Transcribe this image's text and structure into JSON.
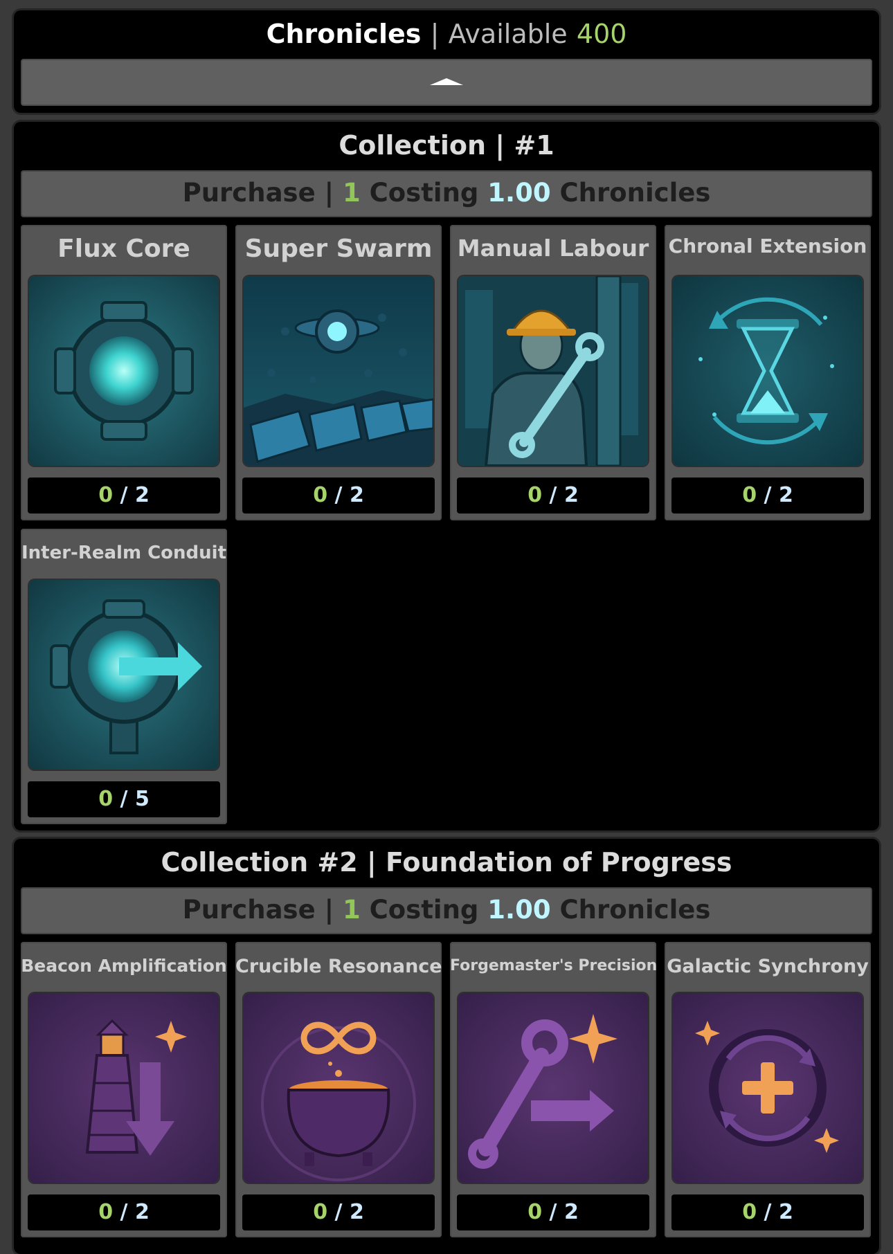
{
  "header": {
    "title": "Chronicles",
    "separator": "|",
    "available_label": "Available",
    "available_value": "400"
  },
  "collections": [
    {
      "title": "Collection | #1",
      "purchase": {
        "label": "Purchase",
        "separator": "|",
        "quantity": "1",
        "costing_label": "Costing",
        "cost": "1.00",
        "currency": "Chronicles"
      },
      "cards": [
        {
          "name": "Flux Core",
          "icon": "flux-core-icon",
          "owned": "0",
          "max": "2"
        },
        {
          "name": "Super Swarm",
          "icon": "drone-swarm-icon",
          "owned": "0",
          "max": "2"
        },
        {
          "name": "Manual Labour",
          "icon": "worker-wrench-icon",
          "owned": "0",
          "max": "2"
        },
        {
          "name": "Chronal Extension",
          "icon": "hourglass-cycle-icon",
          "owned": "0",
          "max": "2"
        },
        {
          "name": "Inter-Realm Conduit",
          "icon": "conduit-arrow-icon",
          "owned": "0",
          "max": "5"
        }
      ]
    },
    {
      "title": "Collection #2 | Foundation of Progress",
      "purchase": {
        "label": "Purchase",
        "separator": "|",
        "quantity": "1",
        "costing_label": "Costing",
        "cost": "1.00",
        "currency": "Chronicles"
      },
      "cards": [
        {
          "name": "Beacon Amplification",
          "icon": "lighthouse-arrow-icon",
          "owned": "0",
          "max": "2"
        },
        {
          "name": "Crucible Resonance",
          "icon": "cauldron-infinity-icon",
          "owned": "0",
          "max": "2"
        },
        {
          "name": "Forgemaster's Precision",
          "icon": "wrench-sparkle-icon",
          "owned": "0",
          "max": "2"
        },
        {
          "name": "Galactic Synchrony",
          "icon": "cycle-plus-icon",
          "owned": "0",
          "max": "2"
        }
      ]
    }
  ],
  "colors": {
    "accent_green": "#a6d36b",
    "accent_cyan": "#bff6ff",
    "teal_art": "#1a4f5a",
    "purple_art": "#4a2a5e"
  }
}
